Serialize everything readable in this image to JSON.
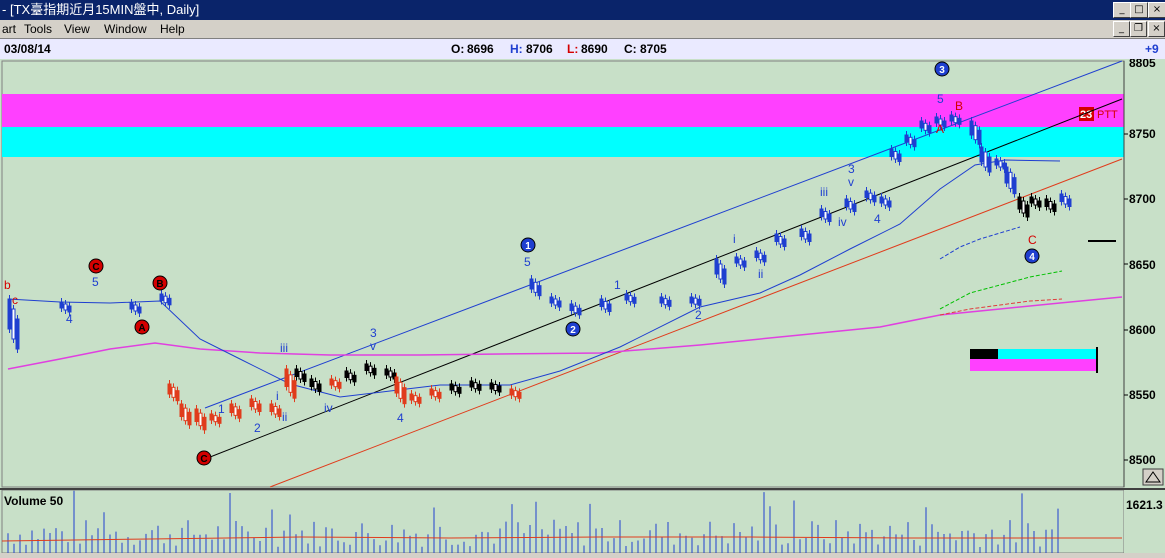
{
  "window": {
    "title_prefix": "-",
    "title": "[TX臺指期近月15MIN盤中, Daily]",
    "buttons": {
      "minimize": "_",
      "maximize": "□",
      "close": "×"
    }
  },
  "menu": {
    "items": [
      {
        "label": "art"
      },
      {
        "label": "Tools"
      },
      {
        "label": "View"
      },
      {
        "label": "Window"
      },
      {
        "label": "Help"
      }
    ],
    "doc_buttons": {
      "minimize": "_",
      "restore": "❐",
      "close": "×"
    }
  },
  "info": {
    "date": "03/08/14",
    "open_label": "O:",
    "open": "8696",
    "high_label": "H:",
    "high": "8706",
    "low_label": "L:",
    "low": "8690",
    "close_label": "C:",
    "close": "8705",
    "change": "+9"
  },
  "price_axis": {
    "ticks": [
      "8750",
      "8700",
      "8650",
      "8600",
      "8550",
      "8500"
    ],
    "top_partial": "8805"
  },
  "volume_panel": {
    "label": "Volume 50",
    "value": "1621.3"
  },
  "indicator": {
    "badge": "23",
    "label": "PTT"
  },
  "wave_labels": [
    {
      "t": "b",
      "c": "#d40000"
    },
    {
      "t": "c",
      "c": "#d40000"
    },
    {
      "t": "5",
      "c": "#1f3fd0"
    },
    {
      "t": "4",
      "c": "#1f3fd0"
    },
    {
      "t": "1",
      "c": "#1f3fd0"
    },
    {
      "t": "2",
      "c": "#1f3fd0"
    },
    {
      "t": "i",
      "c": "#1f3fd0"
    },
    {
      "t": "ii",
      "c": "#1f3fd0"
    },
    {
      "t": "iii",
      "c": "#1f3fd0"
    },
    {
      "t": "iv",
      "c": "#1f3fd0"
    },
    {
      "t": "3",
      "c": "#1f3fd0"
    },
    {
      "t": "v",
      "c": "#1f3fd0"
    },
    {
      "t": "4",
      "c": "#1f3fd0"
    },
    {
      "t": "5",
      "c": "#1f3fd0"
    },
    {
      "t": "1",
      "c": "#1f3fd0"
    },
    {
      "t": "2",
      "c": "#1f3fd0"
    },
    {
      "t": "i",
      "c": "#1f3fd0"
    },
    {
      "t": "ii",
      "c": "#1f3fd0"
    },
    {
      "t": "iii",
      "c": "#1f3fd0"
    },
    {
      "t": "iv",
      "c": "#1f3fd0"
    },
    {
      "t": "3",
      "c": "#1f3fd0"
    },
    {
      "t": "v",
      "c": "#1f3fd0"
    },
    {
      "t": "4",
      "c": "#1f3fd0"
    },
    {
      "t": "5",
      "c": "#1f3fd0"
    },
    {
      "t": "A",
      "c": "#d40000"
    },
    {
      "t": "C",
      "c": "#d40000"
    }
  ],
  "circle_labels": [
    {
      "t": "C",
      "kind": "red"
    },
    {
      "t": "B",
      "kind": "red"
    },
    {
      "t": "A",
      "kind": "red"
    },
    {
      "t": "C",
      "kind": "red"
    },
    {
      "t": "1",
      "kind": "blue"
    },
    {
      "t": "2",
      "kind": "blue"
    },
    {
      "t": "3",
      "kind": "blue"
    },
    {
      "t": "4",
      "kind": "blue"
    }
  ],
  "extra_labels": {
    "B": "B"
  },
  "colors": {
    "background": "#c8e0c8",
    "magenta_zone": "#ff40ff",
    "cyan_zone": "#00ffff",
    "titlebar": "#0a246a"
  }
}
